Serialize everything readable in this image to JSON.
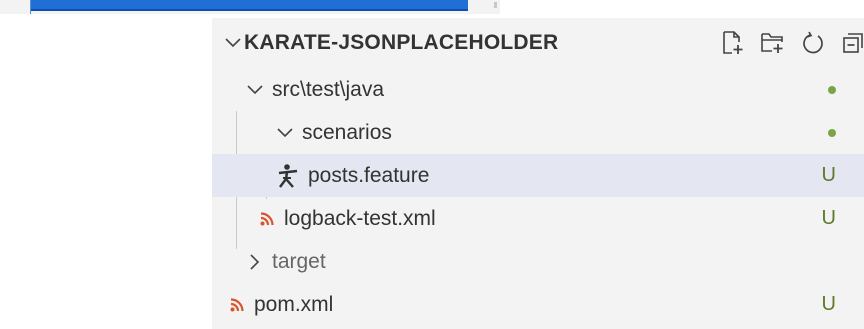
{
  "explorer": {
    "title": "KARATE-JSONPLACEHOLDER",
    "actions": [
      {
        "icon": "new-file-icon"
      },
      {
        "icon": "new-folder-icon"
      },
      {
        "icon": "refresh-icon"
      },
      {
        "icon": "collapse-all-icon"
      }
    ],
    "tree": [
      {
        "label": "src\\test\\java",
        "kind": "folder",
        "expanded": true,
        "status": "dot"
      },
      {
        "label": "scenarios",
        "kind": "folder",
        "expanded": true,
        "status": "dot"
      },
      {
        "label": "posts.feature",
        "kind": "file",
        "icon": "karate-icon",
        "status": "U",
        "selected": true
      },
      {
        "label": "logback-test.xml",
        "kind": "file",
        "icon": "xml-feed-icon",
        "status": "U"
      },
      {
        "label": "target",
        "kind": "folder",
        "expanded": false
      },
      {
        "label": "pom.xml",
        "kind": "file",
        "icon": "xml-feed-icon",
        "status": "U"
      }
    ]
  },
  "colors": {
    "status_untracked": "#5c7a2a",
    "status_dot": "#79a548",
    "selection": "#e4e6f1",
    "xml_icon": "#d9532c"
  }
}
